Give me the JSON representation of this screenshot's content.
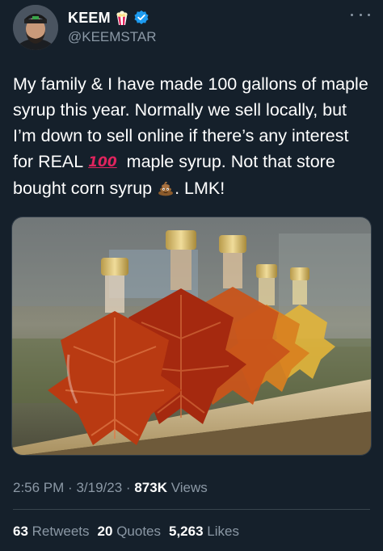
{
  "author": {
    "display_name": "KEEM",
    "handle": "@KEEMSTAR",
    "verified": true,
    "name_emoji": "popcorn-icon"
  },
  "tweet": {
    "lines": [
      "My family & I have made 100 gallons of maple",
      "syrup this year. Normally we sell locally, but",
      "I’m down to sell online if there’s any interest",
      "for REAL",
      "maple syrup. Not that store",
      "bought corn syrup",
      ".   LMK!"
    ],
    "hundred_emoji": "100",
    "poop_emoji": "poop-icon"
  },
  "media": {
    "alt": "",
    "bottle_colors": [
      "#b93a12",
      "#a5290f",
      "#c9541a",
      "#d9801f",
      "#e2b53a"
    ]
  },
  "meta": {
    "time": "2:56 PM",
    "sep1": "·",
    "date": "3/19/23",
    "sep2": "·",
    "views_count": "873K",
    "views_label": "Views"
  },
  "stats": {
    "retweets_count": "63",
    "retweets_label": "Retweets",
    "quotes_count": "20",
    "quotes_label": "Quotes",
    "likes_count": "5,263",
    "likes_label": "Likes"
  },
  "colors": {
    "background": "#15202b",
    "secondary_text": "#8b98a5",
    "verified_blue": "#1d9bf0",
    "divider": "#38444d"
  }
}
